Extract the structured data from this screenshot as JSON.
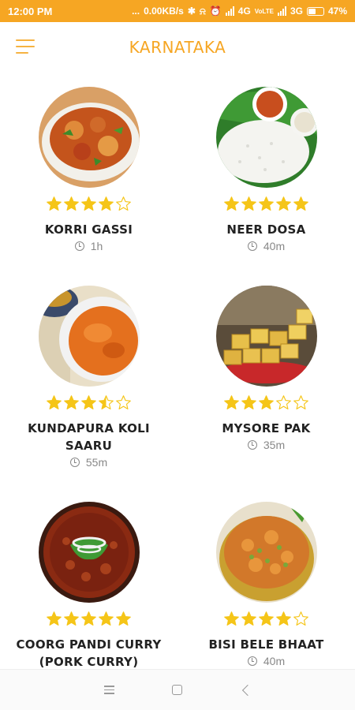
{
  "status_bar": {
    "time": "12:00 PM",
    "dots": "...",
    "speed": "0.00KB/s",
    "net1": "4G",
    "net2": "3G",
    "battery": "47%"
  },
  "app_bar": {
    "title": "KARNATAKA",
    "accent_color": "#f6a623",
    "menu_icon": "hamburger-menu-icon"
  },
  "recipes": [
    {
      "name": "KORRI GASSI",
      "time": "1h",
      "rating": 4,
      "max_rating": 5
    },
    {
      "name": "NEER DOSA",
      "time": "40m",
      "rating": 5,
      "max_rating": 5
    },
    {
      "name": "KUNDAPURA KOLI SAARU",
      "time": "55m",
      "rating": 3.5,
      "max_rating": 5
    },
    {
      "name": "MYSORE PAK",
      "time": "35m",
      "rating": 3,
      "max_rating": 5
    },
    {
      "name": "COORG PANDI CURRY (PORK CURRY)",
      "time": "",
      "rating": 5,
      "max_rating": 5
    },
    {
      "name": "BISI BELE BHAAT",
      "time": "40m",
      "rating": 4,
      "max_rating": 5
    }
  ],
  "star_color": "#f5c518",
  "nav_bar": {
    "icons": [
      "recents-icon",
      "home-icon",
      "back-icon"
    ]
  }
}
